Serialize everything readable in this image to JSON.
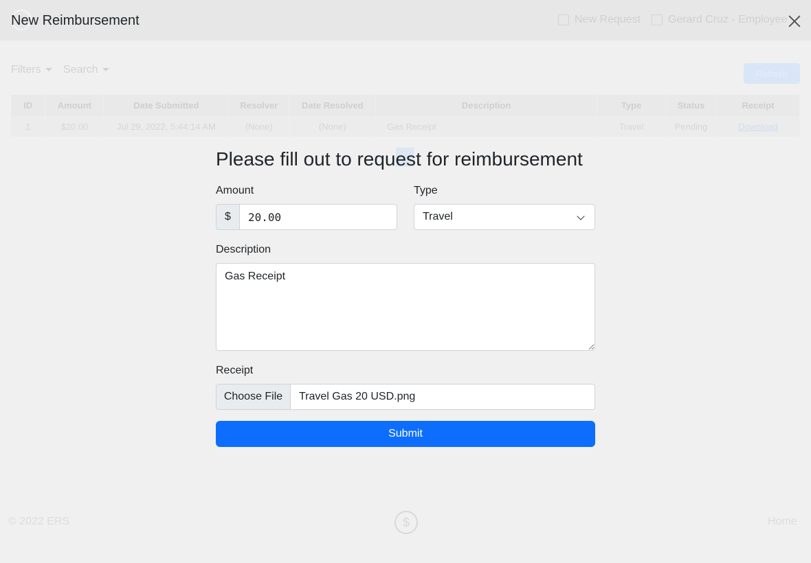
{
  "background": {
    "nav": {
      "new_request": "New Request",
      "user": "Gerard Cruz - Employee"
    },
    "toolbar": {
      "filters": "Filters",
      "search": "Search",
      "refresh": "Refresh"
    },
    "table": {
      "headers": [
        "ID",
        "Amount",
        "Date Submitted",
        "Resolver",
        "Date Resolved",
        "Description",
        "Type",
        "Status",
        "Receipt"
      ],
      "rows": [
        [
          "1",
          "$20.00",
          "Jul 29, 2022, 5:44:14 AM",
          "(None)",
          "(None)",
          "Gas Receipt",
          "Travel",
          "Pending",
          "Download"
        ]
      ]
    },
    "footer": {
      "copyright": "© 2022 ERS",
      "home": "Home"
    }
  },
  "modal": {
    "title": "New Reimbursement",
    "heading": "Please fill out to request for reimbursement",
    "amount": {
      "label": "Amount",
      "prefix": "$",
      "value": "20.00"
    },
    "type": {
      "label": "Type",
      "selected": "Travel"
    },
    "description": {
      "label": "Description",
      "value": "Gas Receipt"
    },
    "receipt": {
      "label": "Receipt",
      "button": "Choose File",
      "file_name": "Travel Gas 20 USD.png"
    },
    "submit_label": "Submit"
  }
}
